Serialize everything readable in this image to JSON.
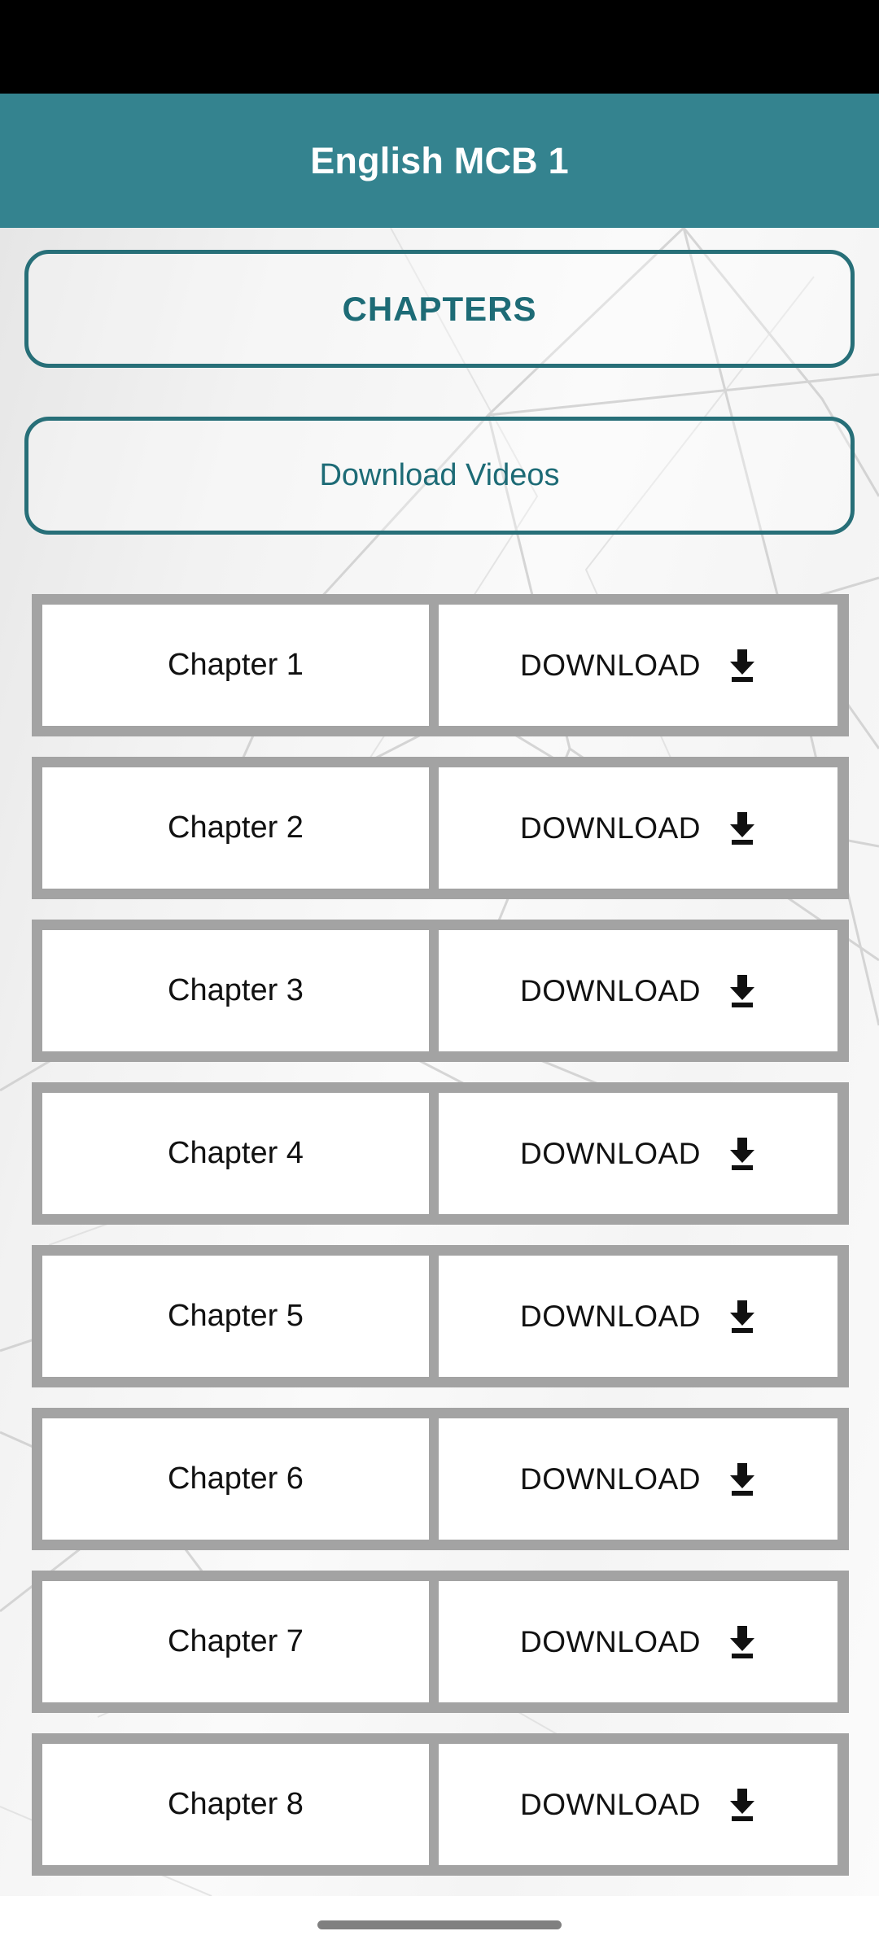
{
  "status_bar": {
    "label": "status-bar"
  },
  "header": {
    "title": "English MCB 1",
    "background_color": "#34838f",
    "text_color": "#ffffff"
  },
  "buttons": {
    "chapters_label": "CHAPTERS",
    "download_videos_label": "Download Videos",
    "outline_color": "#276f78",
    "text_color": "#1d6b76"
  },
  "list": {
    "row_border_color": "#a3a3a3",
    "cell_background": "#ffffff",
    "download_label": "DOWNLOAD",
    "download_icon": "download-arrow-icon",
    "rows": [
      {
        "chapter": "Chapter 1",
        "action": "DOWNLOAD"
      },
      {
        "chapter": "Chapter 2",
        "action": "DOWNLOAD"
      },
      {
        "chapter": "Chapter 3",
        "action": "DOWNLOAD"
      },
      {
        "chapter": "Chapter 4",
        "action": "DOWNLOAD"
      },
      {
        "chapter": "Chapter 5",
        "action": "DOWNLOAD"
      },
      {
        "chapter": "Chapter 6",
        "action": "DOWNLOAD"
      },
      {
        "chapter": "Chapter 7",
        "action": "DOWNLOAD"
      },
      {
        "chapter": "Chapter 8",
        "action": "DOWNLOAD"
      }
    ]
  },
  "nav_bar": {
    "home_indicator": "home-indicator"
  }
}
